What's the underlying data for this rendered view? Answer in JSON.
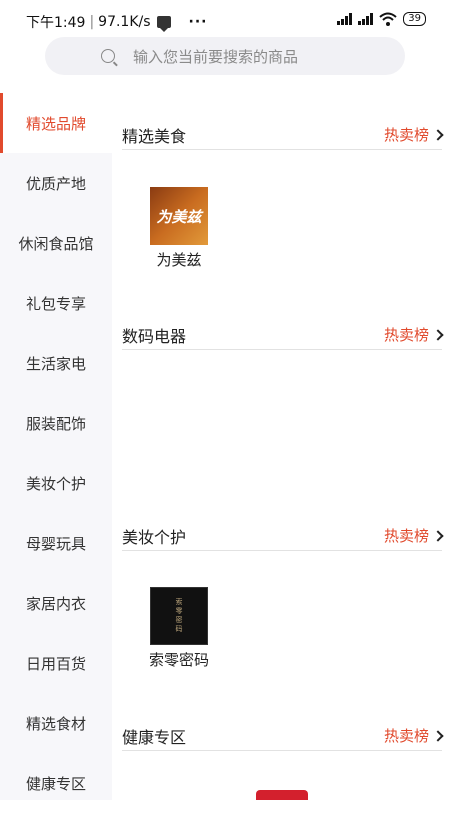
{
  "status_bar": {
    "time": "下午1:49",
    "speed": "97.1K/s",
    "dots": "···",
    "battery": "39"
  },
  "search": {
    "placeholder": "输入您当前要搜索的商品"
  },
  "sidebar": {
    "items": [
      {
        "label": "精选品牌",
        "active": true
      },
      {
        "label": "优质产地"
      },
      {
        "label": "休闲食品馆"
      },
      {
        "label": "礼包专享"
      },
      {
        "label": "生活家电"
      },
      {
        "label": "服装配饰"
      },
      {
        "label": "美妆个护"
      },
      {
        "label": "母婴玩具"
      },
      {
        "label": "家居内衣"
      },
      {
        "label": "日用百货"
      },
      {
        "label": "精选食材"
      },
      {
        "label": "健康专区"
      }
    ]
  },
  "sections": [
    {
      "title": "精选美食",
      "hot": "热卖榜",
      "brands": [
        {
          "name": "为美兹",
          "logo_text": "为美兹"
        }
      ]
    },
    {
      "title": "数码电器",
      "hot": "热卖榜",
      "brands": []
    },
    {
      "title": "美妆个护",
      "hot": "热卖榜",
      "brands": [
        {
          "name": "索零密码",
          "logo_text": "索零密码"
        }
      ]
    },
    {
      "title": "健康专区",
      "hot": "热卖榜",
      "brands": []
    }
  ],
  "colors": {
    "accent": "#e14a2d",
    "sidebar_bg": "#f7f7fa"
  }
}
